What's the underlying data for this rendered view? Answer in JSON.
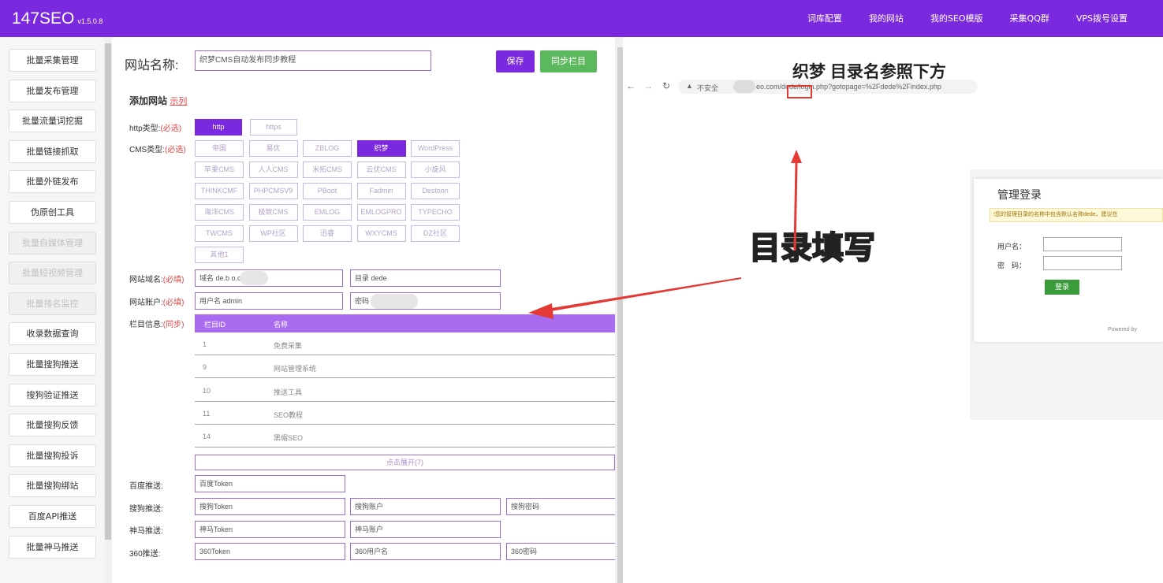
{
  "app": {
    "title": "147SEO",
    "version": "v1.5.0.8"
  },
  "topnav": [
    "词库配置",
    "我的网站",
    "我的SEO模版",
    "采集QQ群",
    "VPS拨号设置"
  ],
  "sidebar": [
    {
      "label": "批量采集管理",
      "enabled": true
    },
    {
      "label": "批量发布管理",
      "enabled": true
    },
    {
      "label": "批量流量词挖掘",
      "enabled": true
    },
    {
      "label": "批量链接抓取",
      "enabled": true
    },
    {
      "label": "批量外链发布",
      "enabled": true
    },
    {
      "label": "伪原创工具",
      "enabled": true
    },
    {
      "label": "批量自媒体管理",
      "enabled": false
    },
    {
      "label": "批量短视频管理",
      "enabled": false
    },
    {
      "label": "批量排名监控",
      "enabled": false
    },
    {
      "label": "收录数据查询",
      "enabled": true
    },
    {
      "label": "批量搜狗推送",
      "enabled": true
    },
    {
      "label": "搜狗验证推送",
      "enabled": true
    },
    {
      "label": "批量搜狗反馈",
      "enabled": true
    },
    {
      "label": "批量搜狗投诉",
      "enabled": true
    },
    {
      "label": "批量搜狗绑站",
      "enabled": true
    },
    {
      "label": "百度API推送",
      "enabled": true
    },
    {
      "label": "批量神马推送",
      "enabled": true
    }
  ],
  "form": {
    "site_name_label": "网站名称:",
    "site_name_value": "织梦CMS自动发布同步教程",
    "save": "保存",
    "sync": "同步栏目",
    "add_site": "添加网站",
    "example": "示列",
    "http_label": "http类型:",
    "required": "(必选)",
    "http_opts": [
      {
        "t": "http",
        "on": true
      },
      {
        "t": "https",
        "on": false
      }
    ],
    "cms_label": "CMS类型:",
    "cms_rows": [
      [
        "帝国",
        "易优",
        "ZBLOG",
        "织梦",
        "WordPress"
      ],
      [
        "苹果CMS",
        "人人CMS",
        "米拓CMS",
        "云优CMS",
        "小旋风"
      ],
      [
        "THINKCMF",
        "PHPCMSV9",
        "PBoot",
        "Fadmin",
        "Destoon"
      ],
      [
        "海洋CMS",
        "极致CMS",
        "EMLOG",
        "EMLOGPRO",
        "TYPECHO"
      ],
      [
        "TWCMS",
        "WP社区",
        "迅睿",
        "WXYCMS",
        "DZ社区"
      ],
      [
        "其他1"
      ]
    ],
    "cms_selected": "织梦",
    "domain_label": "网站域名:",
    "required_fill": "(必填)",
    "domain_value": "域名 de.b    o.com",
    "dir_value": "目录 dede",
    "account_label": "网站账户:",
    "user_value": "用户名 admin",
    "pwd_value": "密码",
    "column_label": "栏目信息:",
    "sync_tag": "(同步)",
    "col_head": [
      "栏目ID",
      "名称"
    ],
    "columns": [
      [
        "1",
        "免费采集"
      ],
      [
        "9",
        "网站管理系统"
      ],
      [
        "10",
        "推送工具"
      ],
      [
        "11",
        "SEO教程"
      ],
      [
        "14",
        "黑帽SEO"
      ]
    ],
    "expand": "点击展开(7)",
    "baidu_label": "百度推送:",
    "baidu_token": "百度Token",
    "sogou_label": "搜狗推送:",
    "sogou_token": "搜狗Token",
    "sogou_account": "搜狗账户",
    "sogou_pwd": "搜狗密码",
    "shenma_label": "神马推送:",
    "shenma_token": "神马Token",
    "shenma_account": "神马账户",
    "s360_label": "360推送:",
    "s360_token": "360Token",
    "s360_user": "360用户名",
    "s360_pwd": "360密码"
  },
  "right": {
    "heading": "织梦 目录名参照下方",
    "insecure": "不安全",
    "url": "eo.com/dede/login.php?gotopage=%2Fdede%2Findex.php",
    "callout": "目录填写",
    "login_title": "管理登录",
    "warn": "!您的管理目录的名称中包含默认名称dede，建议在",
    "user_label": "用户名：",
    "pwd_label": "密　码：",
    "login_btn": "登录",
    "powered": "Powered by"
  },
  "colors": {
    "brand": "#7b29de",
    "accent_green": "#5cb85c",
    "red": "#e53935"
  }
}
